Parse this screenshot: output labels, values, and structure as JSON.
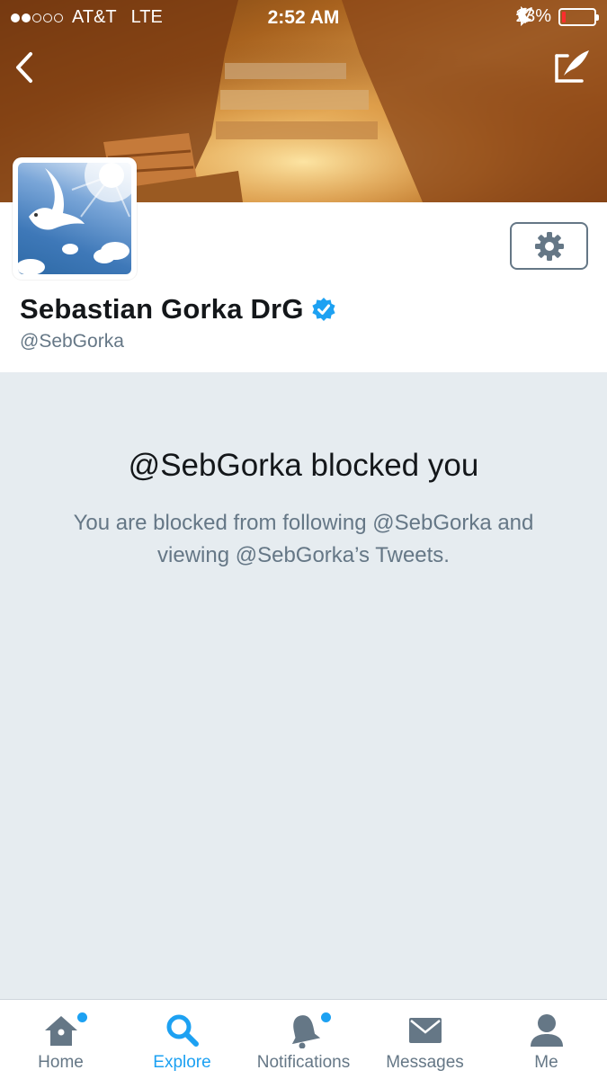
{
  "status_bar": {
    "carrier": "AT&T",
    "network": "LTE",
    "time": "2:52 AM",
    "battery": "13%",
    "battery_level": 0.13,
    "signal_dots_filled": 2,
    "signal_dots_total": 5
  },
  "profile": {
    "name": "Sebastian Gorka DrG",
    "handle": "@SebGorka",
    "verified": true
  },
  "blocked": {
    "title": "@SebGorka blocked you",
    "message": "You are blocked from following @SebGorka and viewing @SebGorka’s Tweets."
  },
  "tabs": [
    {
      "label": "Home",
      "icon": "home-icon",
      "active": false,
      "badge": true
    },
    {
      "label": "Explore",
      "icon": "search-icon",
      "active": true,
      "badge": false
    },
    {
      "label": "Notifications",
      "icon": "bell-icon",
      "active": false,
      "badge": true
    },
    {
      "label": "Messages",
      "icon": "envelope-icon",
      "active": false,
      "badge": false
    },
    {
      "label": "Me",
      "icon": "person-icon",
      "active": false,
      "badge": false
    }
  ],
  "colors": {
    "accent": "#1da1f2",
    "secondary_text": "#657786",
    "blocked_background": "#e6ecf0",
    "battery_low": "#ff2d2d"
  }
}
